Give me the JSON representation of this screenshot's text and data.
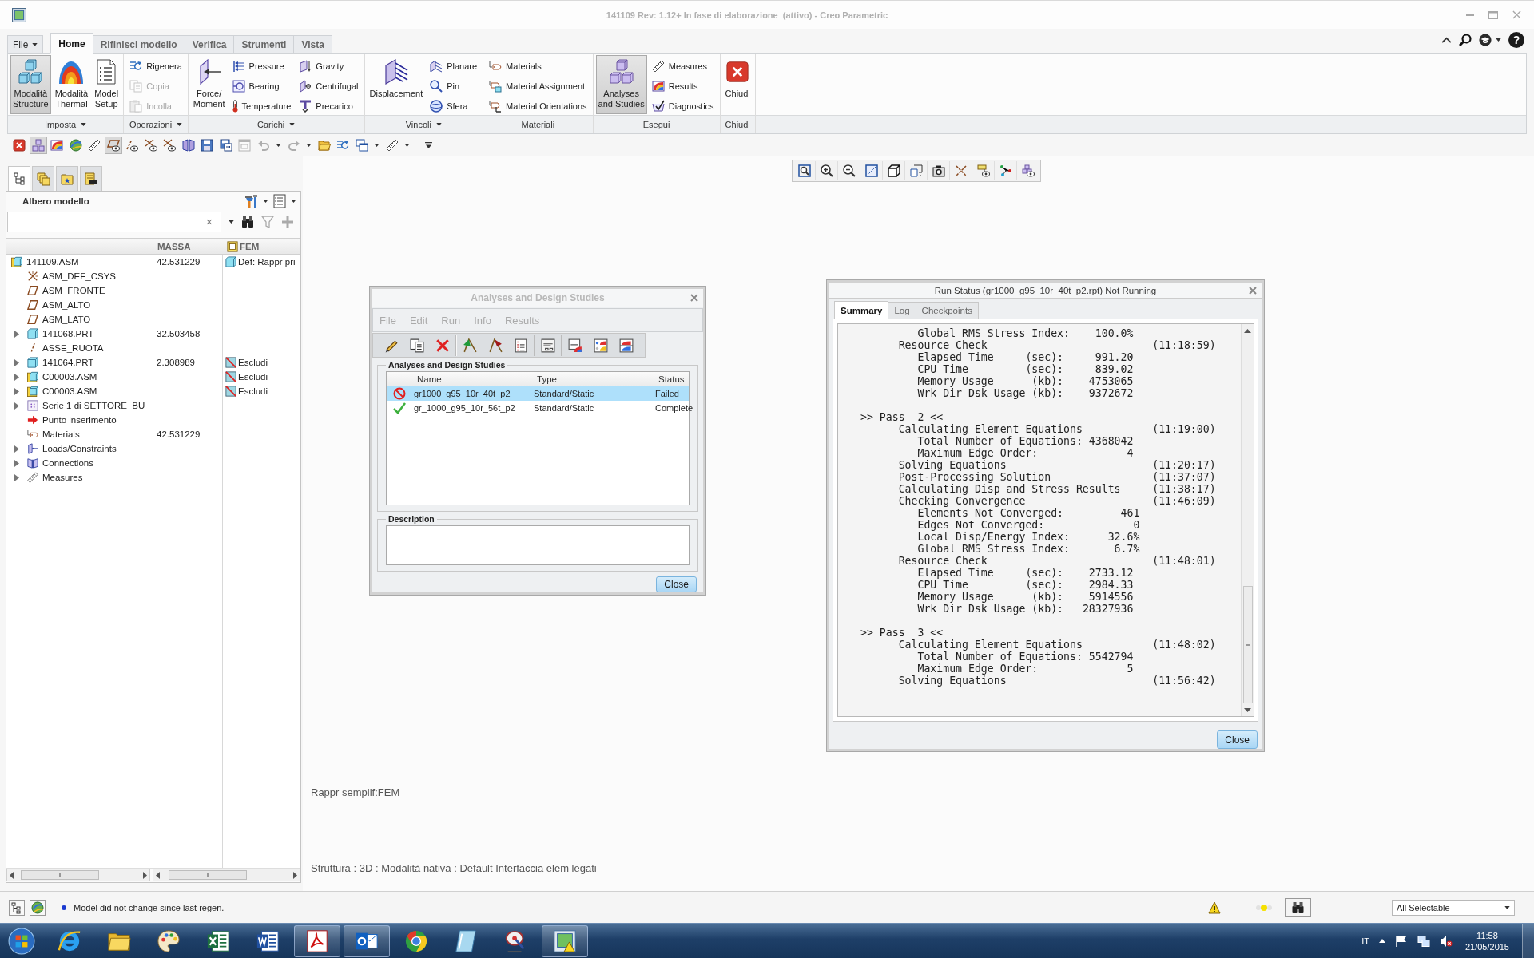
{
  "window": {
    "title": "141109 Rev: 1.12+ In fase di elaborazione  (attivo) - Creo Parametric"
  },
  "ribbon": {
    "tabs": [
      {
        "label": "File",
        "kind": "menu",
        "selected": false
      },
      {
        "label": "Home",
        "kind": "tab",
        "selected": true
      },
      {
        "label": "Rifinisci modello",
        "kind": "tab",
        "selected": false
      },
      {
        "label": "Verifica",
        "kind": "tab",
        "selected": false
      },
      {
        "label": "Strumenti",
        "kind": "tab",
        "selected": false
      },
      {
        "label": "Vista",
        "kind": "tab",
        "selected": false
      }
    ],
    "help": "?",
    "groups": [
      {
        "label": "Imposta",
        "dropdown": true,
        "items": [
          {
            "kind": "large",
            "label": "Modalità\nStructure",
            "pressed": true
          },
          {
            "kind": "large",
            "label": "Modalità\nThermal",
            "pressed": false
          },
          {
            "kind": "large",
            "label": "Model\nSetup",
            "pressed": false
          }
        ]
      },
      {
        "label": "Operazioni",
        "dropdown": true,
        "items": [
          {
            "kind": "small",
            "label": "Rigenera",
            "disabled": false
          },
          {
            "kind": "small",
            "label": "Copia",
            "disabled": true
          },
          {
            "kind": "small",
            "label": "Incolla",
            "disabled": true
          }
        ]
      },
      {
        "label": "Carichi",
        "dropdown": true,
        "items": [
          {
            "kind": "large",
            "label": "Force/\nMoment",
            "pressed": false
          },
          {
            "kind": "small",
            "label": "Pressure",
            "disabled": false
          },
          {
            "kind": "small",
            "label": "Bearing",
            "disabled": false
          },
          {
            "kind": "small",
            "label": "Temperature",
            "disabled": false
          },
          {
            "kind": "small",
            "label": "Gravity",
            "disabled": false
          },
          {
            "kind": "small",
            "label": "Centrifugal",
            "disabled": false
          },
          {
            "kind": "small",
            "label": "Precarico",
            "disabled": false
          }
        ]
      },
      {
        "label": "Vincoli",
        "dropdown": true,
        "items": [
          {
            "kind": "large",
            "label": "Displacement",
            "pressed": false
          },
          {
            "kind": "small",
            "label": "Planare",
            "disabled": false
          },
          {
            "kind": "small",
            "label": "Pin",
            "disabled": false
          },
          {
            "kind": "small",
            "label": "Sfera",
            "disabled": false
          }
        ]
      },
      {
        "label": "Materiali",
        "dropdown": false,
        "items": [
          {
            "kind": "small",
            "label": "Materials",
            "disabled": false
          },
          {
            "kind": "small",
            "label": "Material Assignment",
            "disabled": false
          },
          {
            "kind": "small",
            "label": "Material Orientations",
            "disabled": false
          }
        ]
      },
      {
        "label": "Esegui",
        "dropdown": false,
        "items": [
          {
            "kind": "large",
            "label": "Analyses\nand Studies",
            "pressed": true
          },
          {
            "kind": "small",
            "label": "Measures",
            "disabled": false
          },
          {
            "kind": "small",
            "label": "Results",
            "disabled": false
          },
          {
            "kind": "small",
            "label": "Diagnostics",
            "disabled": false
          }
        ]
      },
      {
        "label": "Chiudi",
        "dropdown": false,
        "items": [
          {
            "kind": "large",
            "label": "Chiudi",
            "pressed": false
          }
        ]
      }
    ]
  },
  "quick_access": [
    {
      "pressed": false,
      "dropdown": false,
      "disabled": false
    },
    {
      "pressed": true,
      "dropdown": false,
      "disabled": false
    },
    {
      "pressed": false,
      "dropdown": false,
      "disabled": false
    },
    {
      "pressed": false,
      "dropdown": false,
      "disabled": false
    },
    {
      "pressed": false,
      "dropdown": false,
      "disabled": false
    },
    {
      "pressed": true,
      "dropdown": false,
      "disabled": false
    },
    {
      "pressed": false,
      "dropdown": false,
      "disabled": false
    },
    {
      "pressed": false,
      "dropdown": false,
      "disabled": false
    },
    {
      "pressed": false,
      "dropdown": false,
      "disabled": false
    },
    {
      "pressed": false,
      "dropdown": false,
      "disabled": false
    },
    {
      "pressed": false,
      "dropdown": false,
      "disabled": false
    },
    {
      "pressed": false,
      "dropdown": false,
      "disabled": false
    },
    {
      "pressed": false,
      "dropdown": false,
      "disabled": true
    },
    {
      "pressed": false,
      "dropdown": true,
      "disabled": true
    },
    {
      "pressed": false,
      "dropdown": true,
      "disabled": true
    },
    {
      "pressed": false,
      "dropdown": false,
      "disabled": false
    },
    {
      "pressed": false,
      "dropdown": false,
      "disabled": false
    },
    {
      "pressed": false,
      "dropdown": true,
      "disabled": false
    },
    {
      "pressed": false,
      "dropdown": true,
      "disabled": false
    }
  ],
  "model_tree": {
    "tabs": [
      {
        "selected": true
      },
      {
        "selected": false
      },
      {
        "selected": false
      },
      {
        "selected": false
      }
    ],
    "title": "Albero modello",
    "clear": "×",
    "columns": [
      "MASSA",
      "FEM"
    ],
    "rows": [
      {
        "name": "141109.ASM",
        "kind": "assembly",
        "massa": "42.531229",
        "fem": {
          "text": "Def: Rappr pri",
          "kind": "default"
        },
        "children": [
          {
            "name": "ASM_DEF_CSYS",
            "kind": "csys"
          },
          {
            "name": "ASM_FRONTE",
            "kind": "plane"
          },
          {
            "name": "ASM_ALTO",
            "kind": "plane"
          },
          {
            "name": "ASM_LATO",
            "kind": "plane"
          },
          {
            "name": "141068.PRT",
            "kind": "part",
            "massa": "32.503458",
            "expanded": false
          },
          {
            "name": "ASSE_RUOTA",
            "kind": "axis"
          },
          {
            "name": "141064.PRT",
            "kind": "part",
            "massa": "2.308989",
            "fem": {
              "text": "Escludi",
              "kind": "excluded"
            },
            "expanded": false
          },
          {
            "name": "C00003.ASM",
            "kind": "assembly",
            "fem": {
              "text": "Escludi",
              "kind": "excluded"
            },
            "expanded": false
          },
          {
            "name": "C00003.ASM",
            "kind": "assembly",
            "fem": {
              "text": "Escludi",
              "kind": "excluded"
            },
            "expanded": false
          },
          {
            "name": "Serie 1 di SETTORE_BU",
            "kind": "pattern",
            "expanded": false
          },
          {
            "name": "Punto inserimento",
            "kind": "point"
          },
          {
            "name": "Materials",
            "kind": "materials",
            "massa": "42.531229"
          },
          {
            "name": "Loads/Constraints",
            "kind": "loads",
            "expanded": false
          },
          {
            "name": "Connections",
            "kind": "connections",
            "expanded": false
          },
          {
            "name": "Measures",
            "kind": "measures",
            "expanded": false
          }
        ]
      }
    ]
  },
  "graphics": {
    "simplified_rep": "Rappr semplif:FEM",
    "info": "Struttura : 3D : Modalità nativa : Default Interfaccia elem legati"
  },
  "analyses_dialog": {
    "title": "Analyses and Design Studies",
    "active": false,
    "menu": [
      "File",
      "Edit",
      "Run",
      "Info",
      "Results"
    ],
    "group_label": "Analyses and Design Studies",
    "columns": [
      "Name",
      "Type",
      "Status"
    ],
    "rows": [
      {
        "kind": "failed",
        "name": "gr1000_g95_10r_40t_p2",
        "type": "Standard/Static",
        "status": "Failed",
        "selected": true
      },
      {
        "kind": "complete",
        "name": "gr_1000_g95_10r_56t_p2",
        "type": "Standard/Static",
        "status": "Complete",
        "selected": false
      }
    ],
    "description_label": "Description",
    "close": "Close"
  },
  "run_status": {
    "title": "Run Status (gr1000_g95_10r_40t_p2.rpt) Not Running",
    "active": true,
    "tabs": [
      {
        "label": "Summary",
        "selected": true
      },
      {
        "label": "Log",
        "selected": false
      },
      {
        "label": "Checkpoints",
        "selected": false
      }
    ],
    "log": [
      [
        "         Global RMS Stress Index:    100.0%",
        "      Resource Check                          (11:18:59)",
        "         Elapsed Time     (sec):     991.20",
        "         CPU Time         (sec):     839.02",
        "         Memory Usage      (kb):    4753065",
        "         Wrk Dir Dsk Usage (kb):    9372672"
      ],
      [
        ">> Pass  2 <<",
        "      Calculating Element Equations           (11:19:00)",
        "         Total Number of Equations: 4368042",
        "         Maximum Edge Order:              4",
        "      Solving Equations                       (11:20:17)",
        "      Post-Processing Solution                (11:37:07)",
        "      Calculating Disp and Stress Results     (11:38:17)",
        "      Checking Convergence                    (11:46:09)",
        "         Elements Not Converged:         461",
        "         Edges Not Converged:              0",
        "         Local Disp/Energy Index:      32.6%",
        "         Global RMS Stress Index:       6.7%",
        "      Resource Check                          (11:48:01)",
        "         Elapsed Time     (sec):    2733.12",
        "         CPU Time         (sec):    2984.33",
        "         Memory Usage      (kb):    5914556",
        "         Wrk Dir Dsk Usage (kb):   28327936"
      ],
      [
        ">> Pass  3 <<",
        "      Calculating Element Equations           (11:48:02)",
        "         Total Number of Equations: 5542794",
        "         Maximum Edge Order:              5",
        "      Solving Equations                       (11:56:42)"
      ]
    ],
    "close": "Close"
  },
  "status_bar": {
    "message": "Model did not change since last regen.",
    "selection_filter": "All Selectable"
  },
  "taskbar": {
    "apps": [
      {
        "running": false
      },
      {
        "running": false
      },
      {
        "running": false
      },
      {
        "running": false
      },
      {
        "running": false
      },
      {
        "running": true
      },
      {
        "running": true
      },
      {
        "running": false
      },
      {
        "running": false
      },
      {
        "running": false
      },
      {
        "running": true
      }
    ],
    "language": "IT",
    "time": "11:58",
    "date": "21/05/2015"
  }
}
